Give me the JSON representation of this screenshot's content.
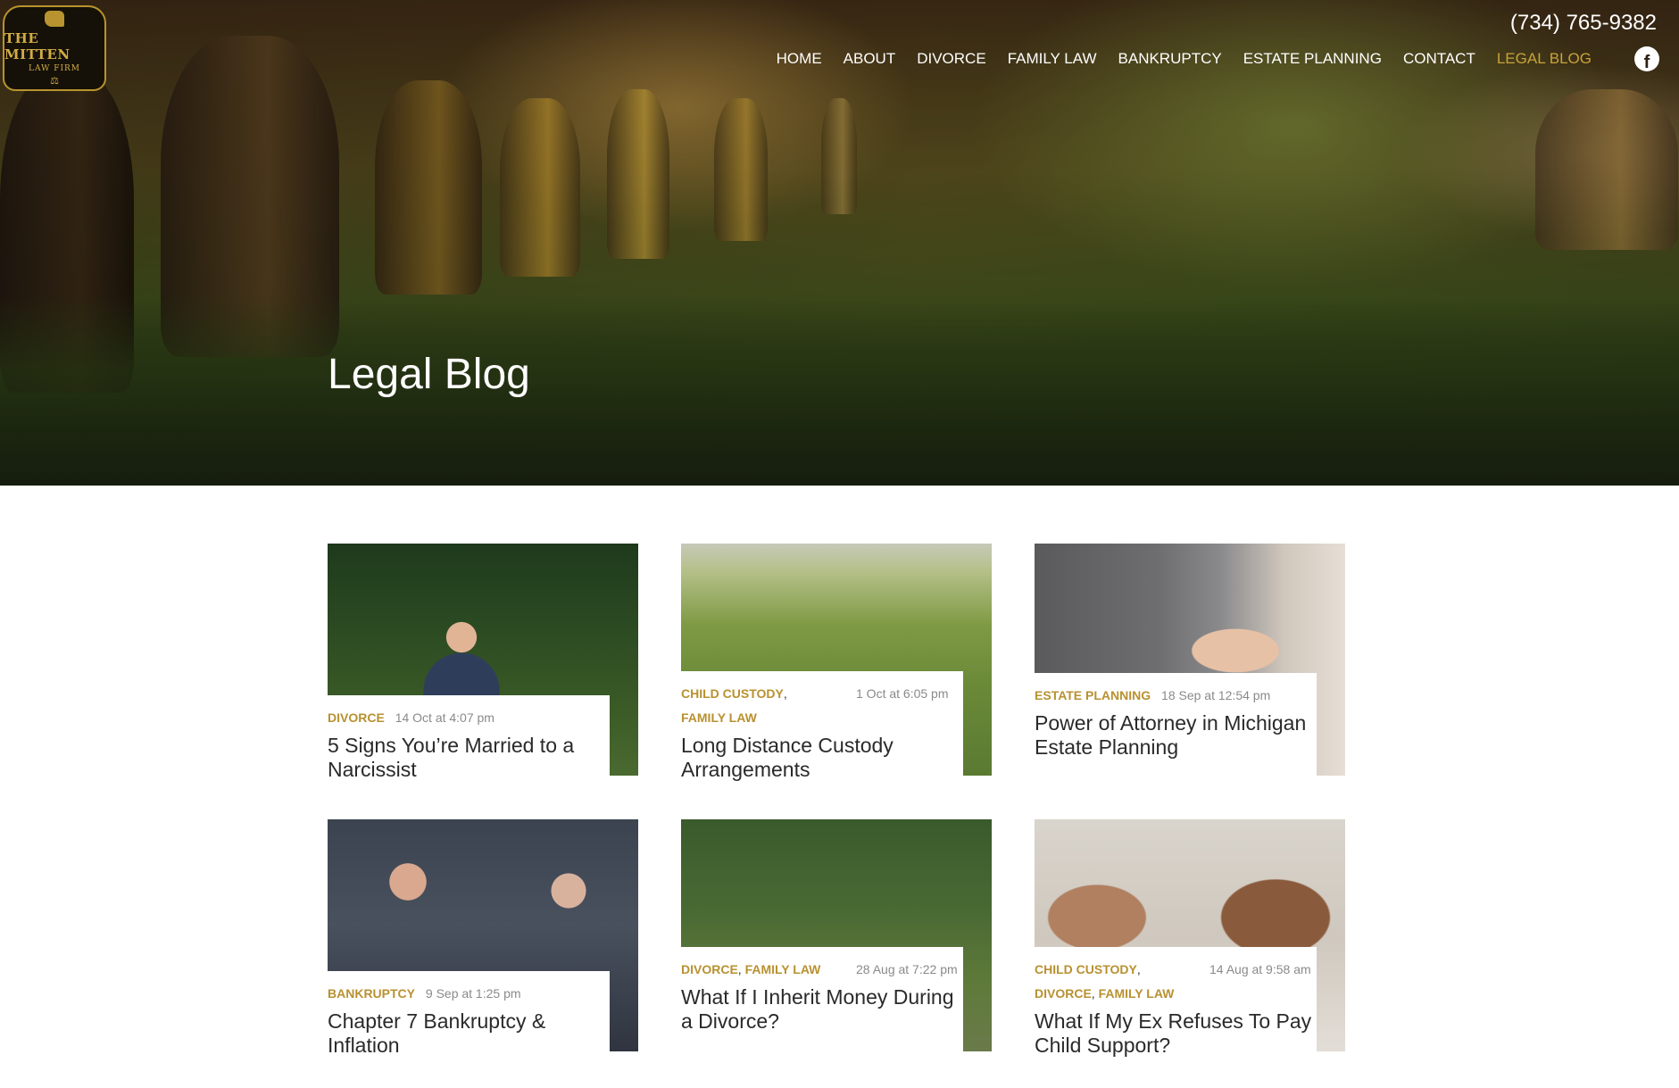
{
  "site": {
    "logo": {
      "line1": "THE MITTEN",
      "line2": "LAW FIRM"
    },
    "phone": "(734) 765-9382",
    "nav": [
      "HOME",
      "ABOUT",
      "DIVORCE",
      "FAMILY LAW",
      "BANKRUPTCY",
      "ESTATE PLANNING",
      "CONTACT",
      "LEGAL BLOG"
    ],
    "active_nav": "LEGAL BLOG",
    "social_icon": "facebook-icon"
  },
  "hero": {
    "title": "Legal Blog"
  },
  "colors": {
    "accent": "#b89130",
    "text": "#2a2a2a",
    "meta": "#8a8a8a"
  },
  "posts": [
    {
      "categories": [
        "DIVORCE"
      ],
      "date": "14 Oct at 4:07 pm",
      "title": "5 Signs You’re Married to a Narcissist"
    },
    {
      "categories": [
        "CHILD CUSTODY",
        "FAMILY LAW"
      ],
      "date": "1 Oct at 6:05 pm",
      "title": "Long Distance Custody Arrangements"
    },
    {
      "categories": [
        "ESTATE PLANNING"
      ],
      "date": "18 Sep at 12:54 pm",
      "title": "Power of Attorney in Michigan Estate Planning"
    },
    {
      "categories": [
        "BANKRUPTCY"
      ],
      "date": "9 Sep at 1:25 pm",
      "title": "Chapter 7 Bankruptcy & Inflation"
    },
    {
      "categories": [
        "DIVORCE",
        "FAMILY LAW"
      ],
      "date": "28 Aug at 7:22 pm",
      "title": "What If I Inherit Money During a Divorce?"
    },
    {
      "categories": [
        "CHILD CUSTODY",
        "DIVORCE",
        "FAMILY LAW"
      ],
      "date": "14 Aug at 9:58 am",
      "title": "What If My Ex Refuses To Pay Child Support?"
    }
  ]
}
